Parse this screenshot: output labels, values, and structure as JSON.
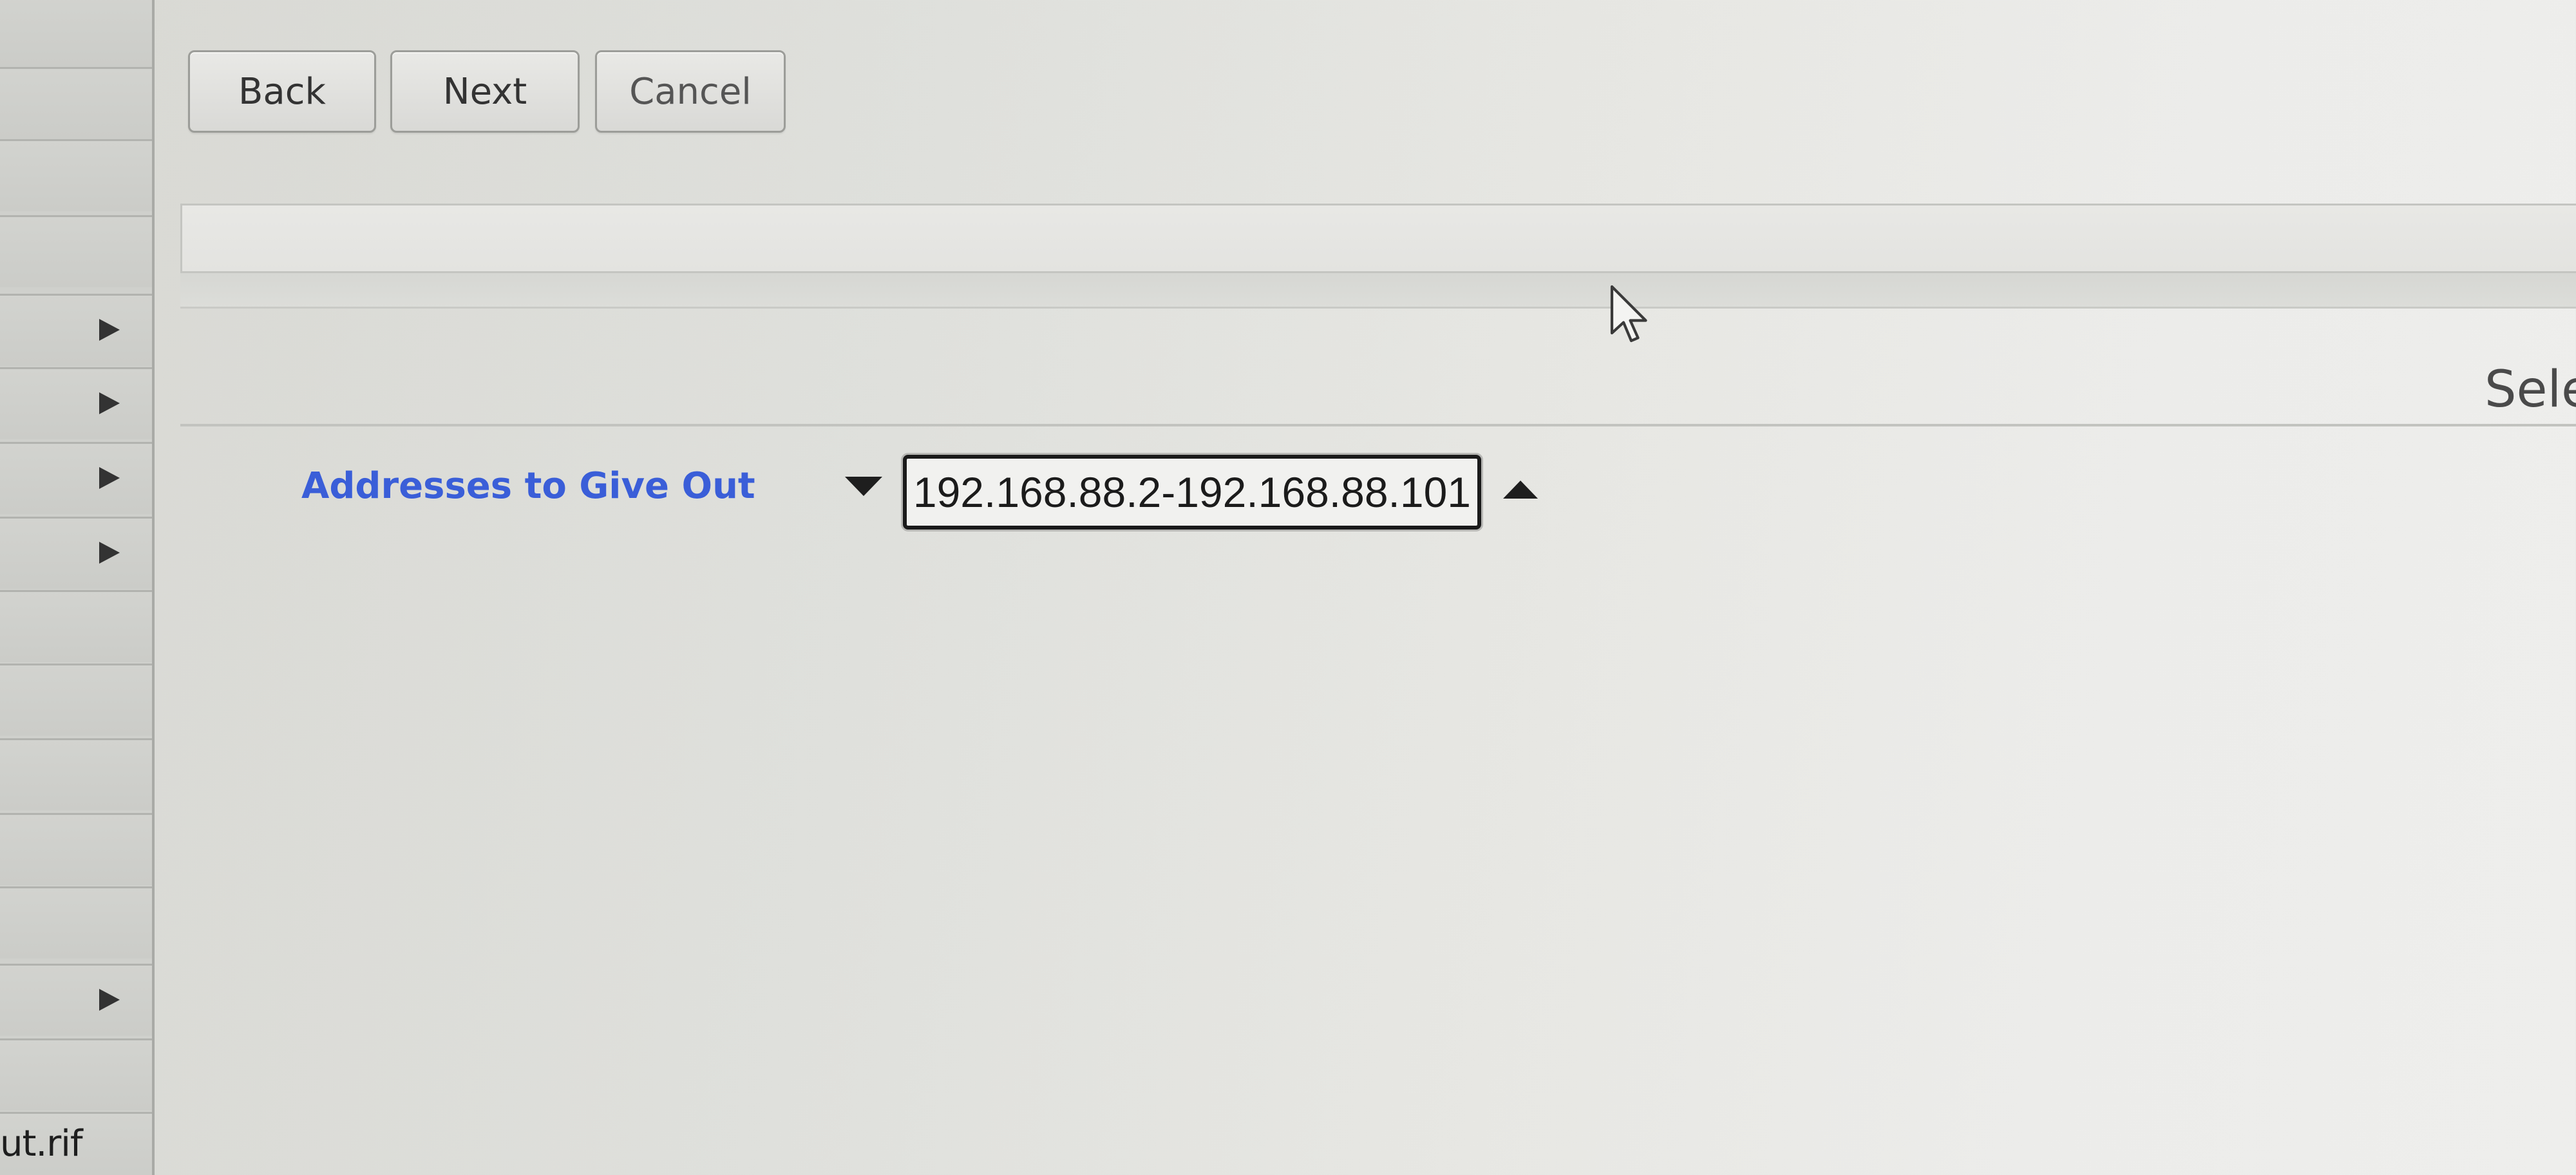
{
  "sidebar": {
    "rows": [
      {
        "has_arrow": false
      },
      {
        "has_arrow": false
      },
      {
        "has_arrow": false
      },
      {
        "has_arrow": false
      },
      {
        "has_arrow": true
      },
      {
        "has_arrow": true
      },
      {
        "has_arrow": true
      },
      {
        "has_arrow": true
      },
      {
        "has_arrow": false
      },
      {
        "has_arrow": false
      },
      {
        "has_arrow": false
      },
      {
        "has_arrow": false
      },
      {
        "has_arrow": false
      },
      {
        "has_arrow": true
      },
      {
        "has_arrow": false
      }
    ],
    "arrow_icon": "triangle-right-icon",
    "file_name": "ut.rif"
  },
  "toolbar": {
    "back_label": "Back",
    "next_label": "Next",
    "cancel_label": "Cancel"
  },
  "header": {
    "partial_text": "Sele"
  },
  "field": {
    "label": "Addresses to Give Out",
    "value": "192.168.88.2-192.168.88.101",
    "decrease_icon": "triangle-down-icon",
    "increase_icon": "triangle-up-icon"
  },
  "colors": {
    "label_link": "#3a5ed8",
    "background": "#e4e4e1",
    "sidebar": "#cfd0cc"
  }
}
